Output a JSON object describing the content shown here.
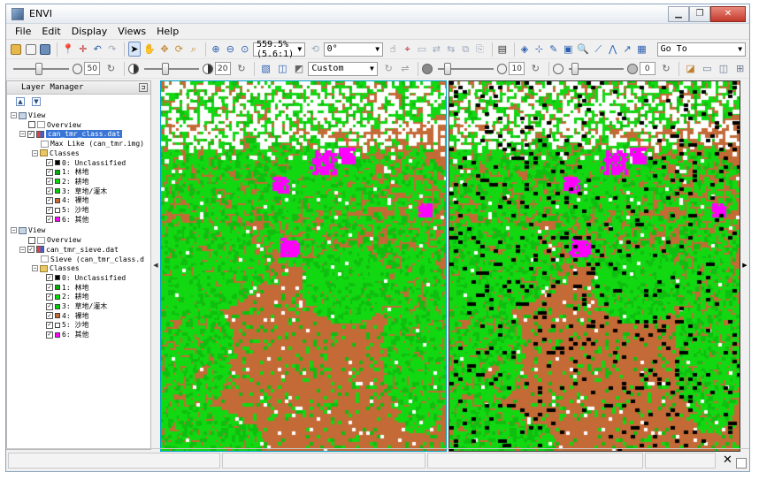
{
  "window": {
    "title": "ENVI"
  },
  "menu": [
    "File",
    "Edit",
    "Display",
    "Views",
    "Help"
  ],
  "toolbar1": {
    "zoom_value": "559.5% (5.6:1)",
    "rotation_value": "0°",
    "goto_placeholder": "Go To"
  },
  "toolbar2": {
    "brightness_value": "50",
    "contrast_value": "20",
    "stretch_value": "Custom",
    "sharpen_value": "10",
    "transparency_value": "0",
    "brightness_level": 0.45,
    "contrast_level": 0.35,
    "sharpen_level": 0.12,
    "transparency_level": 0.05
  },
  "layer_manager": {
    "title": "Layer Manager",
    "views": [
      {
        "label": "View",
        "overview": "Overview",
        "layer": "can_tmr_class.dat",
        "layer_selected": true,
        "source": "Max Like (can_tmr.img)",
        "classes_label": "Classes",
        "classes": [
          {
            "label": "0: Unclassified",
            "color": "#000000"
          },
          {
            "label": "1: 林地",
            "color": "#00b000"
          },
          {
            "label": "2: 耕地",
            "color": "#00e000"
          },
          {
            "label": "3: 草地/灌木",
            "color": "#00d000"
          },
          {
            "label": "4: 裸地",
            "color": "#c46a36"
          },
          {
            "label": "5: 沙地",
            "color": "#ffffff"
          },
          {
            "label": "6: 其他",
            "color": "#ff00ff"
          }
        ]
      },
      {
        "label": "View",
        "overview": "Overview",
        "layer": "can_tmr_sieve.dat",
        "layer_selected": false,
        "source": "Sieve (can_tmr_class.d",
        "classes_label": "Classes",
        "classes": [
          {
            "label": "0: Unclassified",
            "color": "#000000"
          },
          {
            "label": "1: 林地",
            "color": "#00b000"
          },
          {
            "label": "2: 耕地",
            "color": "#00e000"
          },
          {
            "label": "3: 草地/灌木",
            "color": "#00d000"
          },
          {
            "label": "4: 裸地",
            "color": "#c46a36"
          },
          {
            "label": "5: 沙地",
            "color": "#ffffff"
          },
          {
            "label": "6: 其他",
            "color": "#ff00ff"
          }
        ]
      }
    ]
  },
  "colors": {
    "bare": "#c46a36",
    "green": "#12d812",
    "green_dark": "#0fbf0f",
    "sand": "#ffffff",
    "other": "#ff00ff",
    "unclassified": "#000000",
    "left_view_border": "#00a0c8"
  }
}
